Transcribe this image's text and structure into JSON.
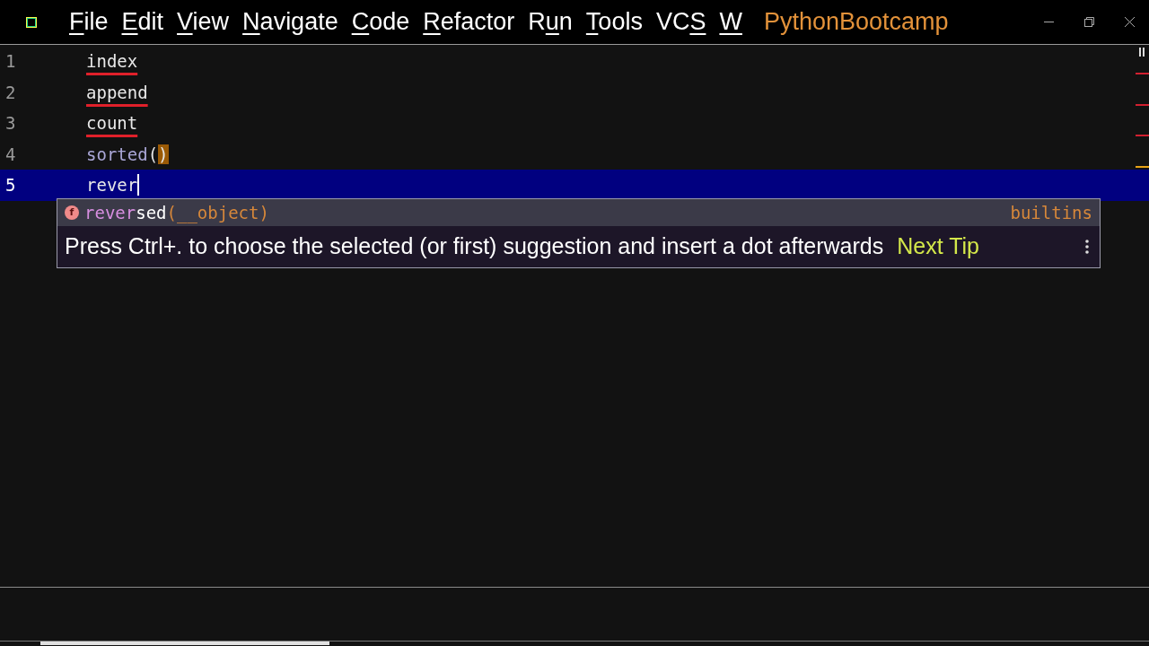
{
  "menu": [
    {
      "key": "F",
      "post": "ile"
    },
    {
      "key": "E",
      "post": "dit"
    },
    {
      "key": "V",
      "post": "iew"
    },
    {
      "key": "N",
      "post": "avigate"
    },
    {
      "key": "C",
      "post": "ode"
    },
    {
      "key": "R",
      "post": "efactor"
    },
    {
      "pre": "R",
      "key": "u",
      "post": "n"
    },
    {
      "key": "T",
      "post": "ools"
    },
    {
      "pre": "VC",
      "key": "S"
    },
    {
      "key": "W"
    }
  ],
  "project": "PythonBootcamp",
  "editor": {
    "lines": [
      {
        "number": "1",
        "error": true,
        "current": false,
        "segments": [
          {
            "text": "index",
            "kind": "plain"
          }
        ]
      },
      {
        "number": "2",
        "error": true,
        "current": false,
        "segments": [
          {
            "text": "append",
            "kind": "plain"
          }
        ]
      },
      {
        "number": "3",
        "error": true,
        "current": false,
        "segments": [
          {
            "text": "count",
            "kind": "plain"
          }
        ]
      },
      {
        "number": "4",
        "error": false,
        "current": false,
        "segments": [
          {
            "text": "sorted",
            "kind": "builtin"
          },
          {
            "text": "(",
            "kind": "plain"
          },
          {
            "text": ")",
            "kind": "brace_match"
          }
        ]
      },
      {
        "number": "5",
        "error": false,
        "current": true,
        "segments": [
          {
            "text": "rever",
            "kind": "plain"
          }
        ]
      }
    ]
  },
  "completion": {
    "items": [
      {
        "icon": "f",
        "match": "rever",
        "rest": "sed",
        "params": "(__object)",
        "source": "builtins",
        "selected": true
      }
    ],
    "tip": "Press Ctrl+. to choose the selected (or first) suggestion and insert a dot afterwards",
    "next_tip": "Next Tip"
  }
}
